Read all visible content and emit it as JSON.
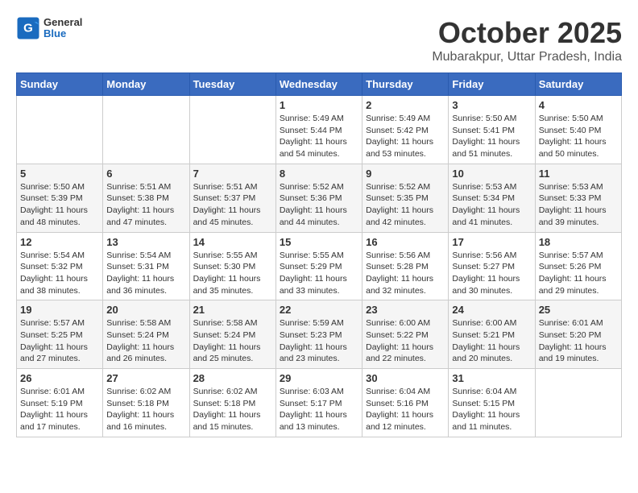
{
  "header": {
    "logo": {
      "general": "General",
      "blue": "Blue"
    },
    "title": "October 2025",
    "subtitle": "Mubarakpur, Uttar Pradesh, India"
  },
  "days_of_week": [
    "Sunday",
    "Monday",
    "Tuesday",
    "Wednesday",
    "Thursday",
    "Friday",
    "Saturday"
  ],
  "weeks": [
    [
      {
        "day": "",
        "sunrise": "",
        "sunset": "",
        "daylight": ""
      },
      {
        "day": "",
        "sunrise": "",
        "sunset": "",
        "daylight": ""
      },
      {
        "day": "",
        "sunrise": "",
        "sunset": "",
        "daylight": ""
      },
      {
        "day": "1",
        "sunrise": "Sunrise: 5:49 AM",
        "sunset": "Sunset: 5:44 PM",
        "daylight": "Daylight: 11 hours and 54 minutes."
      },
      {
        "day": "2",
        "sunrise": "Sunrise: 5:49 AM",
        "sunset": "Sunset: 5:42 PM",
        "daylight": "Daylight: 11 hours and 53 minutes."
      },
      {
        "day": "3",
        "sunrise": "Sunrise: 5:50 AM",
        "sunset": "Sunset: 5:41 PM",
        "daylight": "Daylight: 11 hours and 51 minutes."
      },
      {
        "day": "4",
        "sunrise": "Sunrise: 5:50 AM",
        "sunset": "Sunset: 5:40 PM",
        "daylight": "Daylight: 11 hours and 50 minutes."
      }
    ],
    [
      {
        "day": "5",
        "sunrise": "Sunrise: 5:50 AM",
        "sunset": "Sunset: 5:39 PM",
        "daylight": "Daylight: 11 hours and 48 minutes."
      },
      {
        "day": "6",
        "sunrise": "Sunrise: 5:51 AM",
        "sunset": "Sunset: 5:38 PM",
        "daylight": "Daylight: 11 hours and 47 minutes."
      },
      {
        "day": "7",
        "sunrise": "Sunrise: 5:51 AM",
        "sunset": "Sunset: 5:37 PM",
        "daylight": "Daylight: 11 hours and 45 minutes."
      },
      {
        "day": "8",
        "sunrise": "Sunrise: 5:52 AM",
        "sunset": "Sunset: 5:36 PM",
        "daylight": "Daylight: 11 hours and 44 minutes."
      },
      {
        "day": "9",
        "sunrise": "Sunrise: 5:52 AM",
        "sunset": "Sunset: 5:35 PM",
        "daylight": "Daylight: 11 hours and 42 minutes."
      },
      {
        "day": "10",
        "sunrise": "Sunrise: 5:53 AM",
        "sunset": "Sunset: 5:34 PM",
        "daylight": "Daylight: 11 hours and 41 minutes."
      },
      {
        "day": "11",
        "sunrise": "Sunrise: 5:53 AM",
        "sunset": "Sunset: 5:33 PM",
        "daylight": "Daylight: 11 hours and 39 minutes."
      }
    ],
    [
      {
        "day": "12",
        "sunrise": "Sunrise: 5:54 AM",
        "sunset": "Sunset: 5:32 PM",
        "daylight": "Daylight: 11 hours and 38 minutes."
      },
      {
        "day": "13",
        "sunrise": "Sunrise: 5:54 AM",
        "sunset": "Sunset: 5:31 PM",
        "daylight": "Daylight: 11 hours and 36 minutes."
      },
      {
        "day": "14",
        "sunrise": "Sunrise: 5:55 AM",
        "sunset": "Sunset: 5:30 PM",
        "daylight": "Daylight: 11 hours and 35 minutes."
      },
      {
        "day": "15",
        "sunrise": "Sunrise: 5:55 AM",
        "sunset": "Sunset: 5:29 PM",
        "daylight": "Daylight: 11 hours and 33 minutes."
      },
      {
        "day": "16",
        "sunrise": "Sunrise: 5:56 AM",
        "sunset": "Sunset: 5:28 PM",
        "daylight": "Daylight: 11 hours and 32 minutes."
      },
      {
        "day": "17",
        "sunrise": "Sunrise: 5:56 AM",
        "sunset": "Sunset: 5:27 PM",
        "daylight": "Daylight: 11 hours and 30 minutes."
      },
      {
        "day": "18",
        "sunrise": "Sunrise: 5:57 AM",
        "sunset": "Sunset: 5:26 PM",
        "daylight": "Daylight: 11 hours and 29 minutes."
      }
    ],
    [
      {
        "day": "19",
        "sunrise": "Sunrise: 5:57 AM",
        "sunset": "Sunset: 5:25 PM",
        "daylight": "Daylight: 11 hours and 27 minutes."
      },
      {
        "day": "20",
        "sunrise": "Sunrise: 5:58 AM",
        "sunset": "Sunset: 5:24 PM",
        "daylight": "Daylight: 11 hours and 26 minutes."
      },
      {
        "day": "21",
        "sunrise": "Sunrise: 5:58 AM",
        "sunset": "Sunset: 5:24 PM",
        "daylight": "Daylight: 11 hours and 25 minutes."
      },
      {
        "day": "22",
        "sunrise": "Sunrise: 5:59 AM",
        "sunset": "Sunset: 5:23 PM",
        "daylight": "Daylight: 11 hours and 23 minutes."
      },
      {
        "day": "23",
        "sunrise": "Sunrise: 6:00 AM",
        "sunset": "Sunset: 5:22 PM",
        "daylight": "Daylight: 11 hours and 22 minutes."
      },
      {
        "day": "24",
        "sunrise": "Sunrise: 6:00 AM",
        "sunset": "Sunset: 5:21 PM",
        "daylight": "Daylight: 11 hours and 20 minutes."
      },
      {
        "day": "25",
        "sunrise": "Sunrise: 6:01 AM",
        "sunset": "Sunset: 5:20 PM",
        "daylight": "Daylight: 11 hours and 19 minutes."
      }
    ],
    [
      {
        "day": "26",
        "sunrise": "Sunrise: 6:01 AM",
        "sunset": "Sunset: 5:19 PM",
        "daylight": "Daylight: 11 hours and 17 minutes."
      },
      {
        "day": "27",
        "sunrise": "Sunrise: 6:02 AM",
        "sunset": "Sunset: 5:18 PM",
        "daylight": "Daylight: 11 hours and 16 minutes."
      },
      {
        "day": "28",
        "sunrise": "Sunrise: 6:02 AM",
        "sunset": "Sunset: 5:18 PM",
        "daylight": "Daylight: 11 hours and 15 minutes."
      },
      {
        "day": "29",
        "sunrise": "Sunrise: 6:03 AM",
        "sunset": "Sunset: 5:17 PM",
        "daylight": "Daylight: 11 hours and 13 minutes."
      },
      {
        "day": "30",
        "sunrise": "Sunrise: 6:04 AM",
        "sunset": "Sunset: 5:16 PM",
        "daylight": "Daylight: 11 hours and 12 minutes."
      },
      {
        "day": "31",
        "sunrise": "Sunrise: 6:04 AM",
        "sunset": "Sunset: 5:15 PM",
        "daylight": "Daylight: 11 hours and 11 minutes."
      },
      {
        "day": "",
        "sunrise": "",
        "sunset": "",
        "daylight": ""
      }
    ]
  ]
}
